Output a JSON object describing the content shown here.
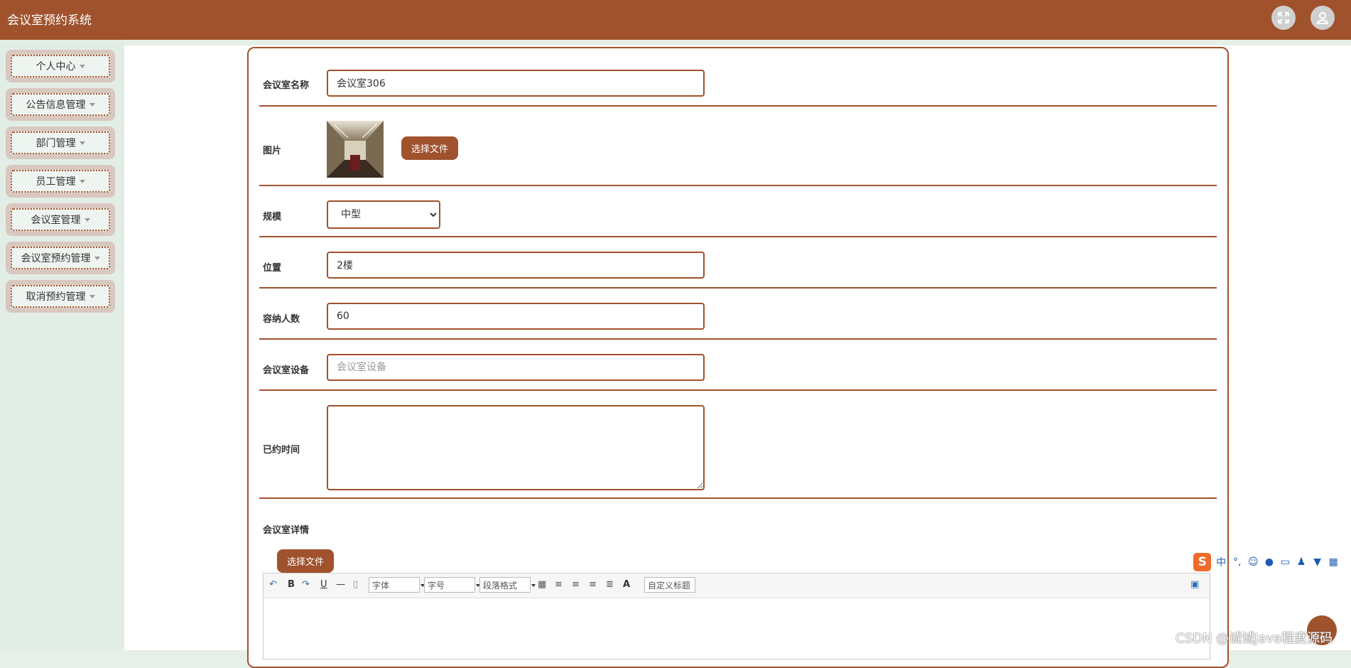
{
  "app": {
    "title": "会议室预约系统"
  },
  "header": {
    "fullscreen_icon": "fullscreen-icon",
    "user_icon": "user-icon"
  },
  "sidebar": {
    "items": [
      {
        "label": "个人中心"
      },
      {
        "label": "公告信息管理"
      },
      {
        "label": "部门管理"
      },
      {
        "label": "员工管理"
      },
      {
        "label": "会议室管理"
      },
      {
        "label": "会议室预约管理"
      },
      {
        "label": "取消预约管理"
      }
    ]
  },
  "form": {
    "name": {
      "label": "会议室名称",
      "value": "会议室306"
    },
    "image": {
      "label": "图片",
      "button": "选择文件"
    },
    "scale": {
      "label": "规模",
      "value": "中型"
    },
    "location": {
      "label": "位置",
      "value": "2楼"
    },
    "capacity": {
      "label": "容纳人数",
      "value": "60"
    },
    "equipment": {
      "label": "会议室设备",
      "value": "",
      "placeholder": "会议室设备"
    },
    "booked_time": {
      "label": "已约时间",
      "value": ""
    },
    "detail": {
      "label": "会议室详情",
      "button": "选择文件"
    }
  },
  "editor_toolbar": {
    "bold": "B",
    "underline": "U",
    "font": "字体",
    "size": "字号",
    "paragraph": "段落格式",
    "font_color": "A",
    "custom_title": "自定义标题"
  },
  "ime": {
    "mode": "中"
  },
  "watermark": "CSDN @诚诚Java程度源码",
  "colors": {
    "accent": "#a0522d",
    "sidebar_bg": "#e2ede6"
  }
}
